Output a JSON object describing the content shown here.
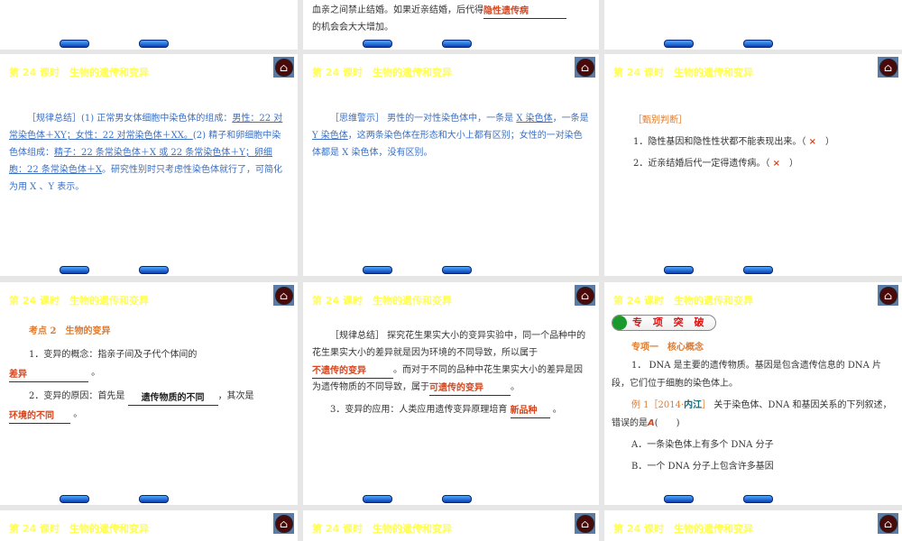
{
  "header": {
    "title": "第 24 课时　生物的遗传和变异"
  },
  "top_middle": {
    "line1": "血亲之间禁止结婚。如果近亲结婚，后代得",
    "answer": "隐性遗传病",
    "line2": "的机会会大大增加。"
  },
  "slide_rule1": {
    "prefix": "［规律总结］(1) 正常男女体细胞中染色体的组成：",
    "u1": "男性：22 对常染色体＋XY；女性：22 对常染色体＋XX。",
    "mid": "(2) 精子和卵细胞中染色体组成：",
    "u2": "精子：22 条常染色体＋X 或 22 条常染色体＋Y；卵细胞：22 条常染色体＋X",
    "suffix": "。研究性别时只考虑性染色体就行了，可简化为用 X 、Y 表示。"
  },
  "slide_warning": {
    "a": "［思维警示］ 男性的一对性染色体中，一条是 ",
    "u1": "X 染色体",
    "b": "，一条是 ",
    "u2": "Y 染色体",
    "c": "，这两条染色体在形态和大小上都有区别；女性的一对染色体都是 X 染色体，没有区别。"
  },
  "slide_judge": {
    "heading": "［甄别判断］",
    "items": [
      {
        "text": "1．隐性基因和隐性性状都不能表现出来。（",
        "mark": "×",
        "close": "）"
      },
      {
        "text": "2．近亲结婚后代一定得遗传病。（",
        "mark": "×",
        "close": "）"
      }
    ]
  },
  "slide_variation": {
    "heading": "考点 2　生物的变异",
    "q1": "1．变异的概念：指亲子间及子代个体间的",
    "a1": "差异",
    "q2a": "2．变异的原因：首先是",
    "a2": "遗传物质的不同",
    "q2b": "，其次是",
    "a3": "环境的不同",
    "end": "。"
  },
  "slide_rule2": {
    "a": "［规律总结］ 探究花生果实大小的变异实验中，同一个品种中的花生果实大小的差异就是因为环境的不同导致，所以属于",
    "ans1": "不遗传的变异",
    "b": "。而对于不同的品种中花生果实大小的差异是因为遗传物质的不同导致，属于",
    "ans2": "可遗传的变异",
    "c": "。",
    "q3": "3．变异的应用：人类应用遗传变异原理培育",
    "ans3": "新品种",
    "end": "。"
  },
  "slide_special": {
    "badge": "专 项 突 破",
    "heading": "专项一　核心概念",
    "p1": "1． DNA 是主要的遗传物质。基因是包含遗传信息的 DNA 片段，它们位于细胞的染色体上。",
    "ex_label": "例 1［2014·",
    "ex_place": "内江",
    "ex_close": "］",
    "ex_text": "关于染色体、DNA 和基因关系的下列叙述，错误的是",
    "ex_ans": "A",
    "ex_paren": "(　　)",
    "optA": "A．一条染色体上有多个 DNA 分子",
    "optB": "B．一个 DNA 分子上包含许多基因"
  }
}
